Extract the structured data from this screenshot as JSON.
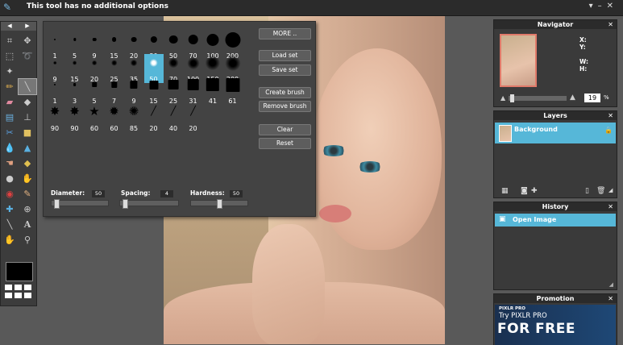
{
  "topbar": {
    "message": "This tool has no additional options"
  },
  "brush": {
    "rows": [
      [
        "1",
        "5",
        "9",
        "15",
        "20",
        "30",
        "50",
        "70",
        "100",
        "200"
      ],
      [
        "9",
        "15",
        "20",
        "25",
        "35",
        "50",
        "70",
        "100",
        "150",
        "200"
      ],
      [
        "1",
        "3",
        "5",
        "7",
        "9",
        "15",
        "25",
        "31",
        "41",
        "61"
      ],
      [
        "90",
        "90",
        "60",
        "60",
        "85",
        "20",
        "40",
        "20"
      ]
    ],
    "selected_label": "50",
    "buttons": [
      "MORE ..",
      "Load set",
      "Save set",
      "Create brush",
      "Remove brush",
      "Clear",
      "Reset"
    ],
    "diameter_label": "Diameter:",
    "diameter_value": "50",
    "diameter_level": 0.05,
    "spacing_label": "Spacing:",
    "spacing_value": "4",
    "spacing_level": 0.04,
    "hardness_label": "Hardness:",
    "hardness_value": "50",
    "hardness_level": 0.5
  },
  "navigator": {
    "title": "Navigator",
    "x_label": "X:",
    "y_label": "Y:",
    "w_label": "W:",
    "h_label": "H:",
    "zoom_value": "19",
    "zoom_unit": "%"
  },
  "layers": {
    "title": "Layers",
    "items": [
      {
        "name": "Background"
      }
    ]
  },
  "history": {
    "title": "History",
    "items": [
      {
        "name": "Open Image"
      }
    ]
  },
  "promotion": {
    "title": "Promotion",
    "brand": "PIXLR PRO",
    "line1": "Try PIXLR PRO",
    "line2": "FOR FREE"
  },
  "colors": {
    "selected": "#56b7d8",
    "panel": "#3a3a3a"
  }
}
